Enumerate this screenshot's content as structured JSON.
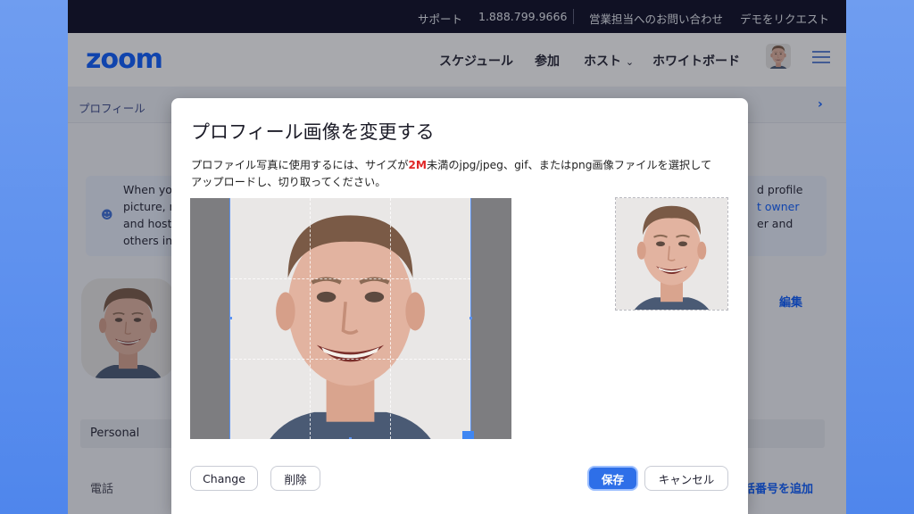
{
  "topbar": {
    "support": "サポート",
    "phone": "1.888.799.9666",
    "contact_sales": "営業担当へのお問い合わせ",
    "request_demo": "デモをリクエスト"
  },
  "nav": {
    "logo": "zoom",
    "schedule": "スケジュール",
    "join": "参加",
    "host": "ホスト",
    "whiteboard": "ホワイトボード"
  },
  "breadcrumb": {
    "label": "プロフィール"
  },
  "infobox": {
    "left_lines": [
      "When yo",
      "picture, n",
      "and host",
      "others in"
    ],
    "right_lines": [
      "d profile",
      "t owner",
      "er and"
    ]
  },
  "profile": {
    "edit_label": "編集"
  },
  "section": {
    "personal_label": "Personal"
  },
  "fields": {
    "phone_label": "電話",
    "add_phone_label": "話番号を追加"
  },
  "modal": {
    "title": "プロフィール画像を変更する",
    "desc_part1": "プロファイル写真に使用するには、サイズが",
    "desc_highlight": "2M",
    "desc_part2": "未満のjpg/jpeg、gif、またはpng画像ファイルを選択して",
    "desc_line2": "アップロードし、切り取ってください。",
    "buttons": {
      "change": "Change",
      "delete": "削除",
      "save": "保存",
      "cancel": "キャンセル"
    }
  },
  "colors": {
    "zoom_blue": "#0b5cff",
    "highlight_red": "#e02828",
    "topbar_bg": "#0b0b23",
    "primary_button": "#2e6fe8"
  }
}
